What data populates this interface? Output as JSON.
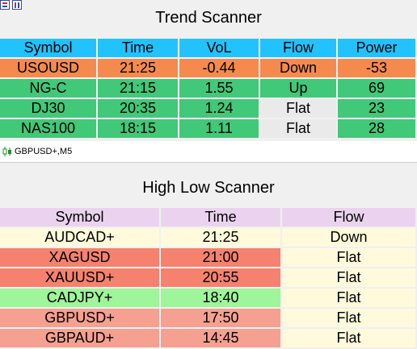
{
  "trend_scanner": {
    "title": "Trend Scanner",
    "headers": [
      "Symbol",
      "Time",
      "VoL",
      "Flow",
      "Power"
    ],
    "rows": [
      {
        "symbol": "USOUSD",
        "time": "21:25",
        "vol": "-0.44",
        "flow": "Down",
        "power": "-53",
        "colors": {
          "symbol": "#f58a4e",
          "time": "#f58a4e",
          "vol": "#f58a4e",
          "flow": "#f58a4e",
          "power": "#f58a4e"
        }
      },
      {
        "symbol": "NG-C",
        "time": "21:15",
        "vol": "1.55",
        "flow": "Up",
        "power": "69",
        "colors": {
          "symbol": "#41c878",
          "time": "#41c878",
          "vol": "#41c878",
          "flow": "#41c878",
          "power": "#41c878"
        }
      },
      {
        "symbol": "DJ30",
        "time": "20:35",
        "vol": "1.24",
        "flow": "Flat",
        "power": "23",
        "colors": {
          "symbol": "#41c878",
          "time": "#41c878",
          "vol": "#41c878",
          "flow": "#eaeaea",
          "power": "#41c878"
        }
      },
      {
        "symbol": "NAS100",
        "time": "18:15",
        "vol": "1.11",
        "flow": "Flat",
        "power": "28",
        "colors": {
          "symbol": "#41c878",
          "time": "#41c878",
          "vol": "#41c878",
          "flow": "#eaeaea",
          "power": "#41c878"
        }
      }
    ]
  },
  "chart_strip": {
    "symbol_label": "GBPUSD+,M5",
    "icon": "candlestick-icon"
  },
  "high_low_scanner": {
    "title": "High Low Scanner",
    "headers": [
      "Symbol",
      "Time",
      "Flow"
    ],
    "rows": [
      {
        "symbol": "AUDCAD+",
        "time": "21:25",
        "flow": "Down",
        "colors": {
          "symbol": "#fffadc",
          "time": "#fffadc",
          "flow": "#fffadc"
        }
      },
      {
        "symbol": "XAGUSD",
        "time": "21:00",
        "flow": "Flat",
        "colors": {
          "symbol": "#f5826e",
          "time": "#f5826e",
          "flow": "#fffadc"
        }
      },
      {
        "symbol": "XAUUSD+",
        "time": "20:55",
        "flow": "Flat",
        "colors": {
          "symbol": "#f5826e",
          "time": "#f5826e",
          "flow": "#fffadc"
        }
      },
      {
        "symbol": "CADJPY+",
        "time": "18:40",
        "flow": "Flat",
        "colors": {
          "symbol": "#9ef59a",
          "time": "#9ef59a",
          "flow": "#fffadc"
        }
      },
      {
        "symbol": "GBPUSD+",
        "time": "17:50",
        "flow": "Flat",
        "colors": {
          "symbol": "#f5a090",
          "time": "#f5a090",
          "flow": "#fffadc"
        }
      },
      {
        "symbol": "GBPAUD+",
        "time": "14:45",
        "flow": "Flat",
        "colors": {
          "symbol": "#f5a090",
          "time": "#f5a090",
          "flow": "#fffadc"
        }
      }
    ]
  },
  "toolbar_icons": [
    "chart-objects-icon",
    "indicators-icon"
  ]
}
